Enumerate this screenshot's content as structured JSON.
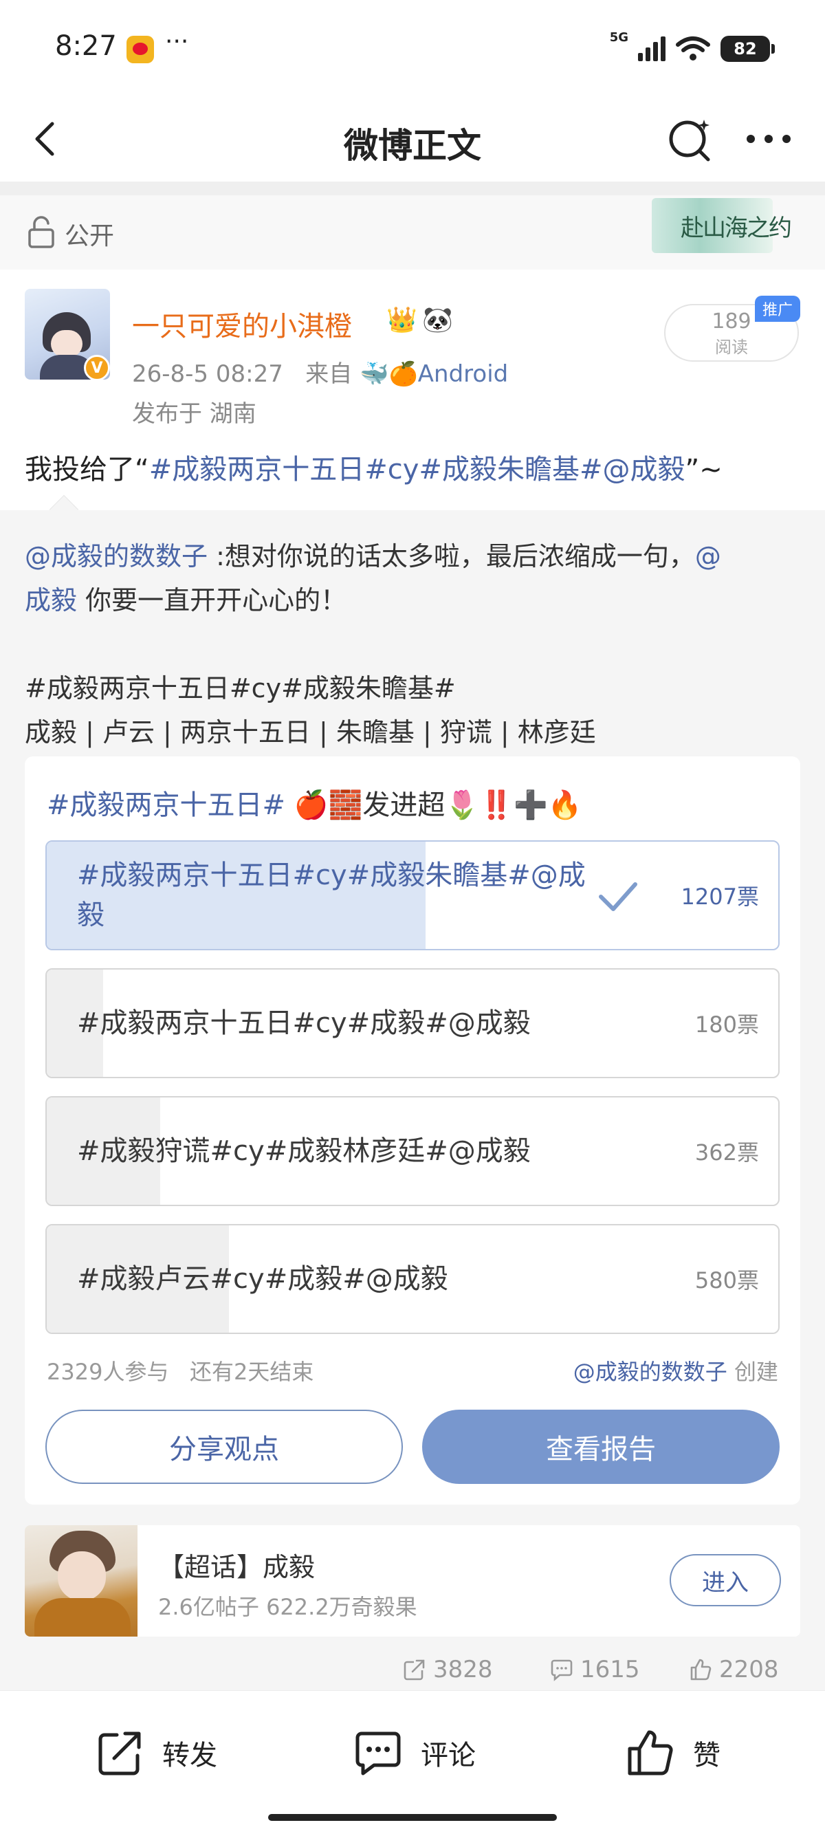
{
  "status_bar": {
    "time": "8:27",
    "dots": "···",
    "network": "5G",
    "battery": "82"
  },
  "nav": {
    "title": "微博正文"
  },
  "visibility": {
    "label": "公开",
    "badge_text": "赴山海之约"
  },
  "post": {
    "username": "一只可爱的小淇橙",
    "user_emoji_1": "👑",
    "user_emoji_2": "🐼",
    "time": "26-8-5 08:27",
    "from_label": "来自",
    "source": "🐳🍊Android",
    "location": "发布于 湖南",
    "reads_count": "189",
    "reads_label": "阅读",
    "promo_tag": "推广",
    "text_prefix": "我投给了“",
    "text_topic": "#成毅两京十五日#cy#成毅朱瞻基#@成毅",
    "text_suffix": "”~"
  },
  "embed": {
    "mention": "@成毅的数数子",
    "line1_text": " :想对你说的话太多啦，最后浓缩成一句，",
    "line1_mention_start": "@",
    "line2_mention": "成毅",
    "line2_text": " 你要一直开开心心的！",
    "tags_line": "#成毅两京十五日#cy#成毅朱瞻基#",
    "keywords_line": "成毅 | 卢云 | 两京十五日 | 朱瞻基  | 狩谎 | 林彦廷"
  },
  "vote": {
    "title_topic": "#成毅两京十五日#",
    "title_text": " 🍎🧱发进超🌷‼️➕🔥",
    "options": [
      {
        "label": "#成毅两京十五日#cy#成毅朱瞻基#@成毅",
        "count": "1207票",
        "votes": 1207,
        "selected": true
      },
      {
        "label": "#成毅两京十五日#cy#成毅#@成毅",
        "count": "180票",
        "votes": 180,
        "selected": false
      },
      {
        "label": "#成毅狩谎#cy#成毅林彦廷#@成毅",
        "count": "362票",
        "votes": 362,
        "selected": false
      },
      {
        "label": "#成毅卢云#cy#成毅#@成毅",
        "count": "580票",
        "votes": 580,
        "selected": false
      }
    ],
    "participants": "2329人参与",
    "remaining": "还有2天结束",
    "creator": "@成毅的数数子",
    "created_label": "创建",
    "share_button": "分享观点",
    "report_button": "查看报告"
  },
  "super_topic": {
    "title": "【超话】成毅",
    "stats": "2.6亿帖子 622.2万奇毅果",
    "enter_button": "进入"
  },
  "stats": {
    "reposts": "3828",
    "comments": "1615",
    "likes": "2208"
  },
  "actions": {
    "repost": "转发",
    "comment": "评论",
    "like": "赞"
  },
  "colors": {
    "link": "#4a65a6",
    "username": "#e86c1a",
    "primary_button": "#7897ce",
    "selected_fill": "#dbe5f5"
  }
}
